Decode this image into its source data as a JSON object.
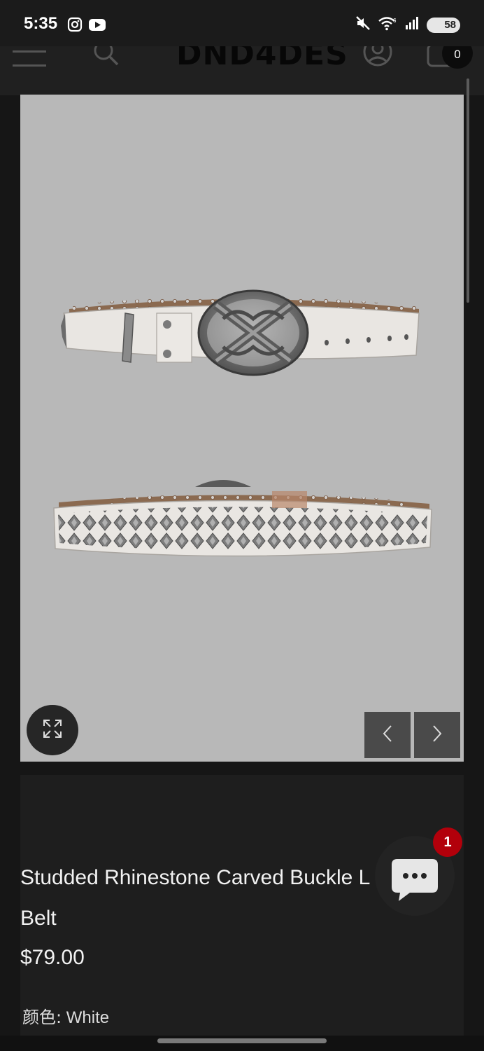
{
  "status_bar": {
    "time": "5:35",
    "battery": "58",
    "left_icons": [
      "instagram-icon",
      "youtube-icon"
    ],
    "right_icons": [
      "mute-icon",
      "wifi-icon",
      "signal-icon",
      "battery-icon"
    ]
  },
  "header": {
    "logo": "DND4DES",
    "cart_count": "0",
    "icons": [
      "menu-icon",
      "search-icon",
      "account-icon",
      "cart-icon"
    ]
  },
  "gallery": {
    "alt": "white studded rhinestone belt with carved buckle"
  },
  "product": {
    "title": "Studded Rhinestone Carved Buckle L Belt",
    "title_line1": "Studded Rhinestone Carved Buckle L",
    "title_line2": "Belt",
    "price": "$79.00",
    "color_label": "颜色:",
    "color_value": "White"
  },
  "chat": {
    "badge": "1"
  },
  "colors": {
    "background": "#161616",
    "header": "#202020",
    "gallery_bg": "#b8b8b8",
    "chat_badge": "#b2000b"
  }
}
